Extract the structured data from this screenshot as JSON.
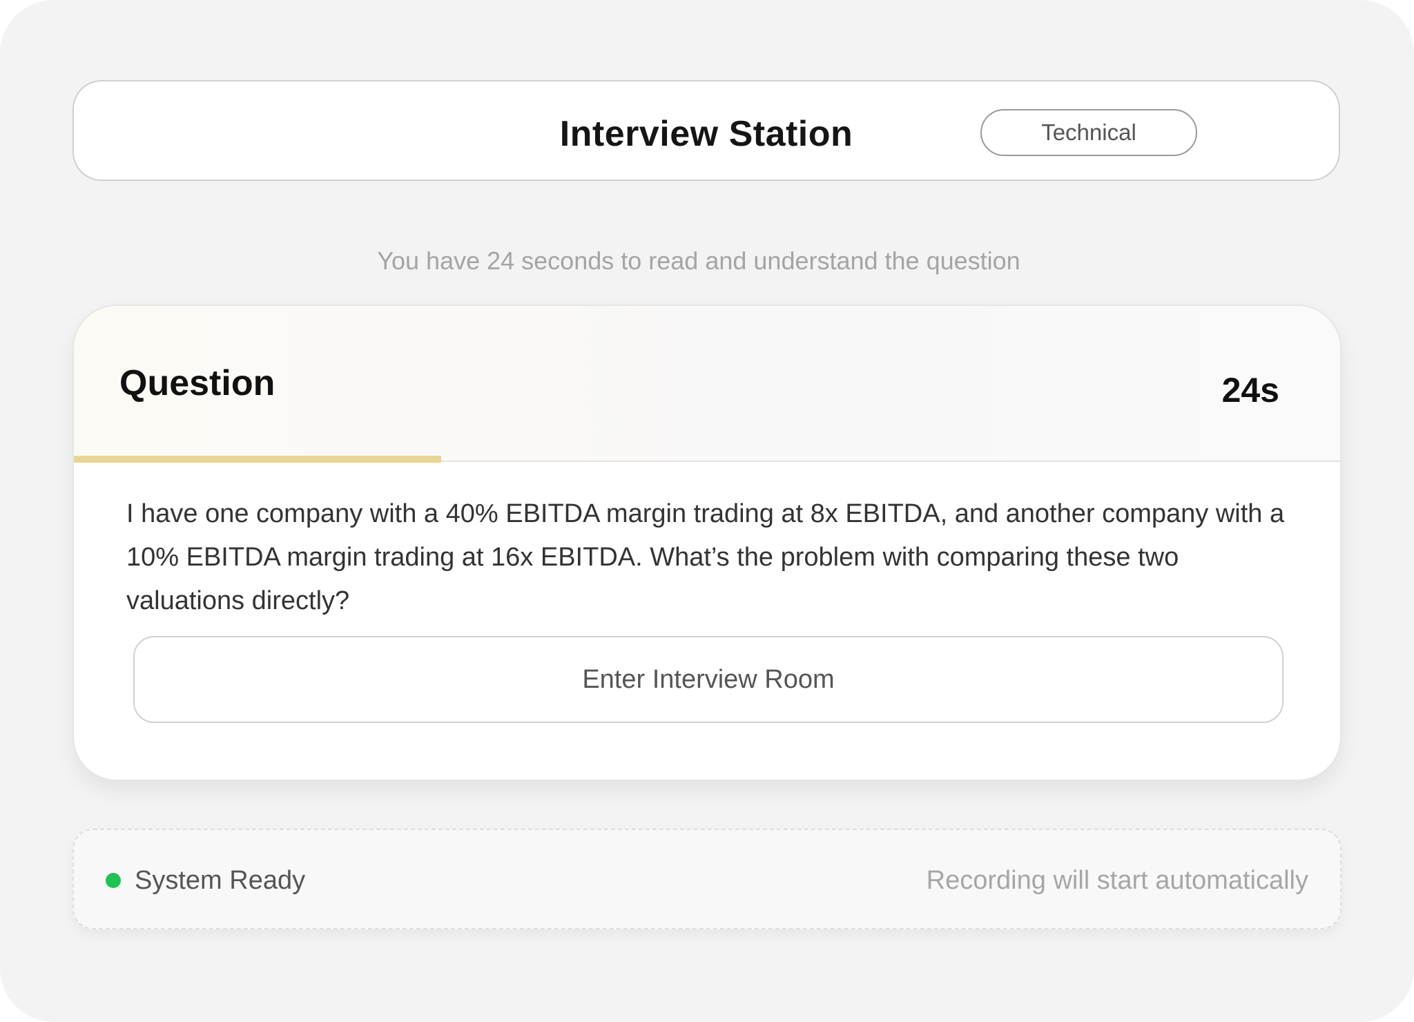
{
  "header": {
    "title": "Interview Station",
    "badge": "Technical"
  },
  "hint": "You have 24 seconds to read and understand the question",
  "question": {
    "heading": "Question",
    "timer": "24s",
    "progress": 0.29,
    "text": "I have one company with a 40% EBITDA margin trading at 8x EBITDA, and another company with a 10% EBITDA margin trading at 16x EBITDA. What’s the problem with comparing these two valuations directly?",
    "enter_button": "Enter Interview Room"
  },
  "status": {
    "label": "System Ready",
    "note": "Recording will start automatically",
    "dot_color": "#21c254"
  },
  "colors": {
    "progress": "#e6d597",
    "background": "#f3f3f3"
  }
}
